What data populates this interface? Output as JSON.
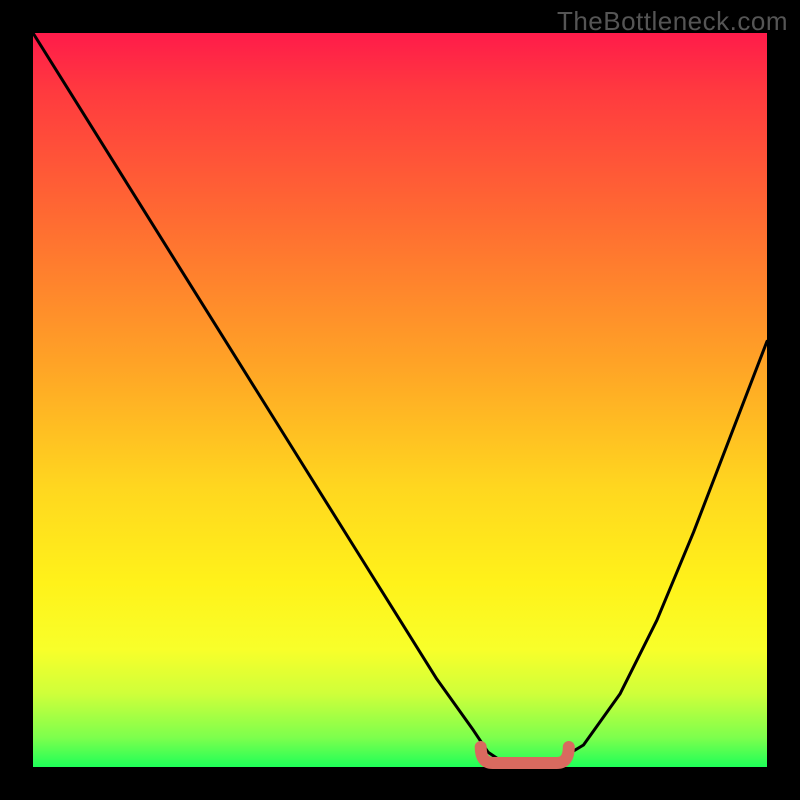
{
  "watermark": "TheBottleneck.com",
  "chart_data": {
    "type": "line",
    "title": "",
    "xlabel": "",
    "ylabel": "",
    "xlim": [
      0,
      100
    ],
    "ylim": [
      0,
      100
    ],
    "grid": false,
    "legend": false,
    "x": [
      0,
      5,
      10,
      15,
      20,
      25,
      30,
      35,
      40,
      45,
      50,
      55,
      60,
      62,
      65,
      70,
      75,
      80,
      85,
      90,
      95,
      100
    ],
    "values": [
      100,
      92,
      84,
      76,
      68,
      60,
      52,
      44,
      36,
      28,
      20,
      12,
      5,
      2,
      0,
      0,
      3,
      10,
      20,
      32,
      45,
      58
    ],
    "series": [
      {
        "name": "bottleneck-curve",
        "color": "#000000",
        "x": [
          0,
          5,
          10,
          15,
          20,
          25,
          30,
          35,
          40,
          45,
          50,
          55,
          60,
          62,
          65,
          70,
          75,
          80,
          85,
          90,
          95,
          100
        ],
        "values": [
          100,
          92,
          84,
          76,
          68,
          60,
          52,
          44,
          36,
          28,
          20,
          12,
          5,
          2,
          0,
          0,
          3,
          10,
          20,
          32,
          45,
          58
        ]
      }
    ],
    "highlight": {
      "name": "optimal-range-marker",
      "color": "#d96a5f",
      "x_range": [
        61,
        73
      ],
      "y": 0
    },
    "background_gradient": {
      "direction": "vertical",
      "stops": [
        {
          "pos": 0,
          "color": "#ff1b4a"
        },
        {
          "pos": 25,
          "color": "#ff6a32"
        },
        {
          "pos": 62,
          "color": "#ffd71f"
        },
        {
          "pos": 84,
          "color": "#f8ff2a"
        },
        {
          "pos": 100,
          "color": "#1eff58"
        }
      ]
    }
  }
}
